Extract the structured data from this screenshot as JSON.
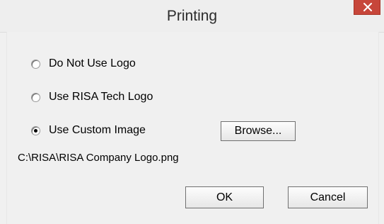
{
  "window": {
    "title": "Printing",
    "close_icon": "close-icon"
  },
  "logo_options": [
    {
      "label": "Do Not Use Logo",
      "selected": false
    },
    {
      "label": "Use RISA Tech Logo",
      "selected": false
    },
    {
      "label": "Use Custom Image",
      "selected": true
    }
  ],
  "browse_label": "Browse...",
  "custom_image_path": "C:\\RISA\\RISA Company Logo.png",
  "buttons": {
    "ok_label": "OK",
    "cancel_label": "Cancel"
  },
  "colors": {
    "close_button": "#c7463a",
    "dialog_background": "#f0f0f0"
  }
}
